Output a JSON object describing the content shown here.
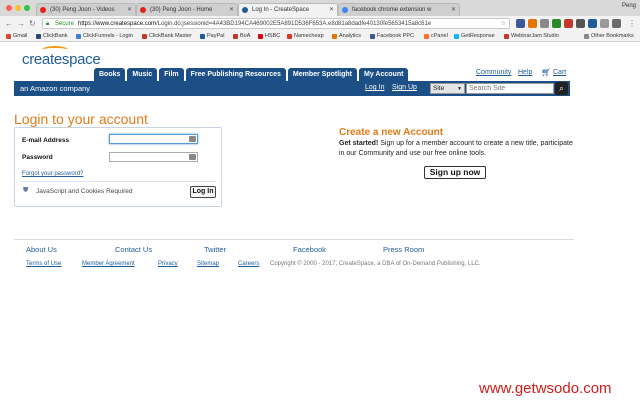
{
  "browser": {
    "profile_name": "Peng",
    "tabs": [
      {
        "label": "(30) Peng Joon - Videos"
      },
      {
        "label": "(30) Peng Joon - Home"
      },
      {
        "label": "Log In - CreateSpace"
      },
      {
        "label": "facebook chrome extension w"
      }
    ],
    "url_secure_label": "Secure",
    "url_host": "https://www.createspace.com",
    "url_path": "/Login.do;jsessionid=4A43BD194CA469002E5A891D536F653A.e8d81a8dadfe40130fe5653415a8c61e",
    "bookmarks": [
      {
        "label": "Gmail",
        "color": "#d44638"
      },
      {
        "label": "ClickBank",
        "color": "#2b4a7a"
      },
      {
        "label": "ClickFunnels - Login",
        "color": "#3b7dd8"
      },
      {
        "label": "ClickBank Master",
        "color": "#c0392b"
      },
      {
        "label": "PayPal",
        "color": "#1f5c99"
      },
      {
        "label": "BoA",
        "color": "#c0392b"
      },
      {
        "label": "HSBC",
        "color": "#db0011"
      },
      {
        "label": "Namecheap",
        "color": "#de3723"
      },
      {
        "label": "Analytics",
        "color": "#e37400"
      },
      {
        "label": "Facebook PPC",
        "color": "#3b5998"
      },
      {
        "label": "cPanel",
        "color": "#ff6c2c"
      },
      {
        "label": "GetResponse",
        "color": "#00baff"
      },
      {
        "label": "WebinarJam Studio",
        "color": "#c0392b"
      }
    ],
    "other_bookmarks": "Other Bookmarks"
  },
  "site": {
    "logo": "createspace",
    "main_tabs": [
      "Books",
      "Music",
      "Film",
      "Free Publishing Resources",
      "Member Spotlight",
      "My Account"
    ],
    "top_links": {
      "community": "Community",
      "help": "Help",
      "cart": "Cart"
    },
    "amazon_label": "an Amazon company",
    "login_link": "Log In",
    "signup_link": "Sign Up",
    "search": {
      "scope": "Site",
      "placeholder": "Search Site"
    }
  },
  "login": {
    "title": "Login to your account",
    "email_label": "E-mail Address",
    "password_label": "Password",
    "email_value": "",
    "password_value": "",
    "forgot": "Forgot your password?",
    "js_notice": "JavaScript and Cookies Required",
    "button": "Log In"
  },
  "create": {
    "title": "Create a new Account",
    "lead": "Get started!",
    "text": " Sign up for a member account to create a new title, participate in our Community and use our free online tools.",
    "button": "Sign up now"
  },
  "footer": {
    "primary": [
      "About Us",
      "Contact Us",
      "Twitter",
      "Facebook",
      "Press Room"
    ],
    "secondary": [
      "Terms of Use",
      "Member Agreement",
      "Privacy",
      "Sitemap",
      "Careers"
    ],
    "copyright": "Copyright © 2000 - 2017, CreateSpace, a DBA of On-Demand Publishing, LLC."
  },
  "watermark": "www.getwsodo.com",
  "colors": {
    "brand_blue": "#1b4f85",
    "accent_orange": "#e07b1a",
    "watermark_red": "#d11a1a"
  }
}
